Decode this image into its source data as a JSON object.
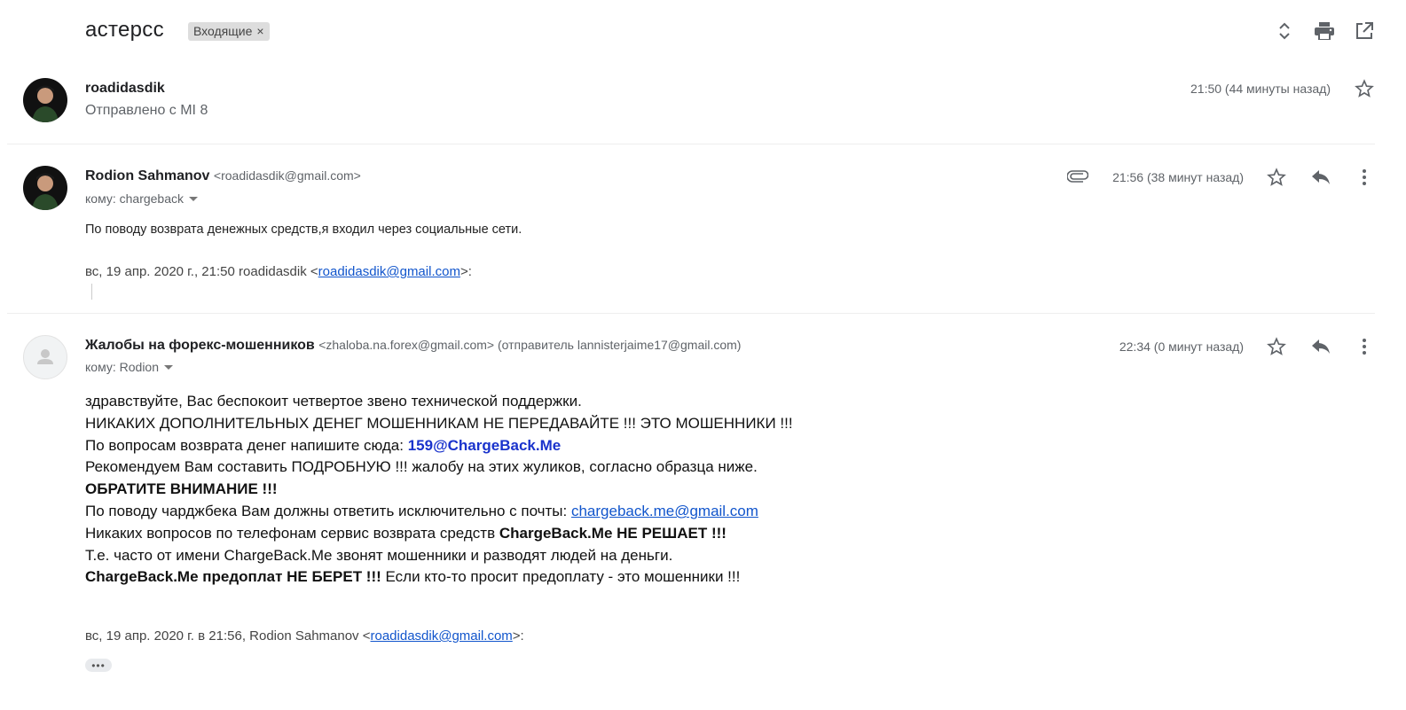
{
  "header": {
    "subject": "астерсс",
    "label": "Входящие",
    "label_remove": "×"
  },
  "messages": [
    {
      "sender": "roadidasdik",
      "snippet": "Отправлено с MI 8",
      "time": "21:50 (44 минуты назад)"
    },
    {
      "sender": "Rodion Sahmanov",
      "email": "<roadidasdik@gmail.com>",
      "to": "кому: chargeback",
      "time": "21:56 (38 минут назад)",
      "body": "По поводу возврата денежных средств,я входил через социальные сети.",
      "quote_prefix": "вс, 19 апр. 2020 г., 21:50 roadidasdik <",
      "quote_email": "roadidasdik@gmail.com",
      "quote_suffix": ">:"
    },
    {
      "sender": "Жалобы на форекс-мошенников",
      "email": "<zhaloba.na.forex@gmail.com> (отправитель lannisterjaime17@gmail.com)",
      "to": "кому: Rodion",
      "time": "22:34 (0 минут назад)",
      "lines": {
        "l1": "здравствуйте, Вас беспокоит четвертое звено технической поддержки.",
        "l2": "НИКАКИХ ДОПОЛНИТЕЛЬНЫХ ДЕНЕГ МОШЕННИКАМ НЕ ПЕРЕДАВАЙТЕ !!! ЭТО МОШЕННИКИ !!!",
        "l3_text": "По вопросам возврата денег напишите сюда: ",
        "l3_link": "159@ChargeBack.Me",
        "l4": "Рекомендуем Вам составить ПОДРОБНУЮ !!! жалобу на этих жуликов, согласно образца ниже.",
        "l5": "ОБРАТИТЕ ВНИМАНИЕ !!!",
        "l6_text": "По поводу чарджбека Вам должны ответить исключительно с почты: ",
        "l6_link": "chargeback.me@gmail.com",
        "l7_text": "Никаких вопросов по телефонам сервис возврата средств ",
        "l7_bold": "ChargeBack.Me НЕ РЕШАЕТ !!!",
        "l8": "Т.е. часто от имени ChargeBack.Me звонят мошенники и разводят людей на деньги.",
        "l9_bold": "ChargeBack.Me предоплат НЕ БЕРЕТ !!!",
        "l9_text": " Если кто-то просит предоплату - это мошенники !!!"
      },
      "quote_prefix": "вс, 19 апр. 2020 г. в 21:56, Rodion Sahmanov <",
      "quote_email": "roadidasdik@gmail.com",
      "quote_suffix": ">:",
      "show_trimmed": "•••"
    }
  ],
  "icons": {
    "expand": "unfold-icon",
    "print": "print-icon",
    "popout": "open-in-new-icon",
    "star": "star-icon",
    "reply": "reply-icon",
    "more": "more-vert-icon",
    "attachment": "attachment-icon"
  }
}
